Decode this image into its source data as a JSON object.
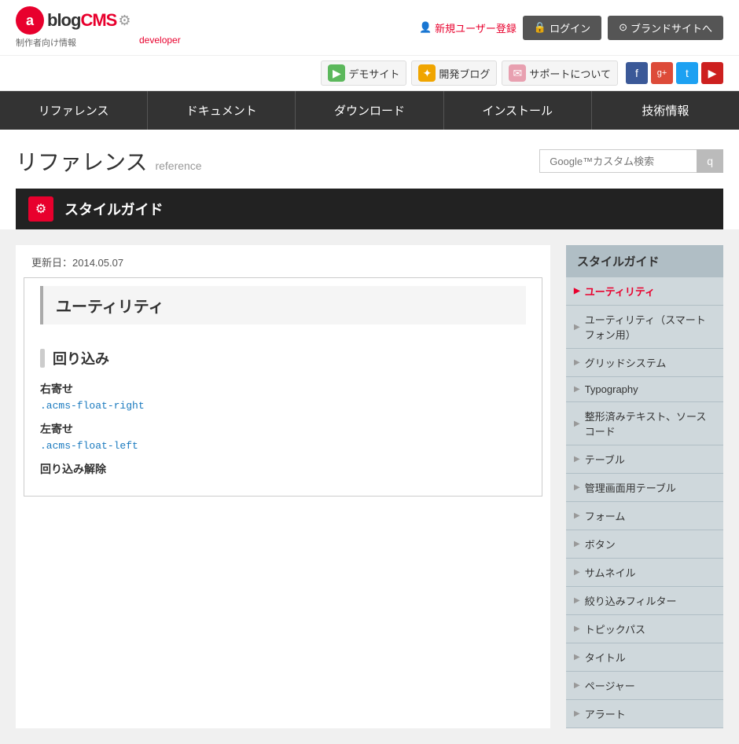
{
  "header": {
    "logo": {
      "a_letter": "a",
      "blog_text": "blog",
      "cms_text": "CMS",
      "gear_symbol": "⚙",
      "sub_text": "制作者向け情報",
      "dev_text": "developer"
    },
    "register_label": "新規ユーザー登録",
    "login_label": "ログイン",
    "brand_label": "ブランドサイトへ",
    "quick_links": [
      {
        "label": "デモサイト",
        "icon": "▶"
      },
      {
        "label": "開発ブログ",
        "icon": "✦"
      },
      {
        "label": "サポートについて",
        "icon": "✉"
      }
    ],
    "social": [
      {
        "name": "facebook",
        "symbol": "f"
      },
      {
        "name": "google-plus",
        "symbol": "g+"
      },
      {
        "name": "twitter",
        "symbol": "t"
      },
      {
        "name": "youtube",
        "symbol": "▶"
      }
    ]
  },
  "nav": {
    "items": [
      {
        "label": "リファレンス"
      },
      {
        "label": "ドキュメント"
      },
      {
        "label": "ダウンロード"
      },
      {
        "label": "インストール"
      },
      {
        "label": "技術情報"
      }
    ]
  },
  "page": {
    "title_jp": "リファレンス",
    "title_en": "reference",
    "search_placeholder": "Google™カスタム検索",
    "search_btn_label": "q"
  },
  "section": {
    "icon": "⚙",
    "title": "スタイルガイド"
  },
  "content": {
    "update_date": "更新日：2014.05.07",
    "main_title": "ユーティリティ",
    "subsection": "回り込み",
    "items": [
      {
        "label": "右寄せ",
        "code": ".acms-float-right"
      },
      {
        "label": "左寄せ",
        "code": ".acms-float-left"
      },
      {
        "label": "回り込み解除",
        "code": ""
      }
    ]
  },
  "sidebar": {
    "title": "スタイルガイド",
    "items": [
      {
        "label": "ユーティリティ",
        "active": true
      },
      {
        "label": "ユーティリティ（スマートフォン用）",
        "active": false
      },
      {
        "label": "グリッドシステム",
        "active": false
      },
      {
        "label": "Typography",
        "active": false
      },
      {
        "label": "整形済みテキスト、ソースコード",
        "active": false
      },
      {
        "label": "テーブル",
        "active": false
      },
      {
        "label": "管理画面用テーブル",
        "active": false
      },
      {
        "label": "フォーム",
        "active": false
      },
      {
        "label": "ボタン",
        "active": false
      },
      {
        "label": "サムネイル",
        "active": false
      },
      {
        "label": "絞り込みフィルター",
        "active": false
      },
      {
        "label": "トピックパス",
        "active": false
      },
      {
        "label": "タイトル",
        "active": false
      },
      {
        "label": "ページャー",
        "active": false
      },
      {
        "label": "アラート",
        "active": false
      }
    ]
  }
}
